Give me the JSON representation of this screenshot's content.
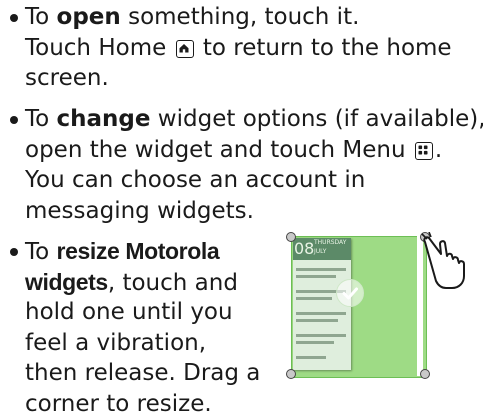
{
  "bullets": [
    {
      "lines": [
        "To ",
        "open",
        " something, touch it.",
        "Touch Home",
        "to return to the home",
        "screen."
      ]
    },
    {
      "lines": [
        "To ",
        "change",
        " widget options (if available),",
        "open the widget and touch Menu",
        ".",
        "You can choose an account in",
        "messaging widgets."
      ]
    },
    {
      "lines": [
        "To ",
        "resize Motorola",
        "widgets",
        ", touch and",
        "hold one until you",
        "feel a vibration,",
        "then release. Drag a",
        "corner to resize."
      ]
    }
  ],
  "icons": {
    "home": "home-icon",
    "menu": "menu-icon",
    "hand": "touch-hand-icon"
  },
  "widget_illustration": {
    "day": "08",
    "weekday": "THURSDAY",
    "month": "JULY"
  },
  "colors": {
    "text": "#1a1a1a",
    "highlight": "#9edb85",
    "widget_header": "#5c8a68"
  }
}
